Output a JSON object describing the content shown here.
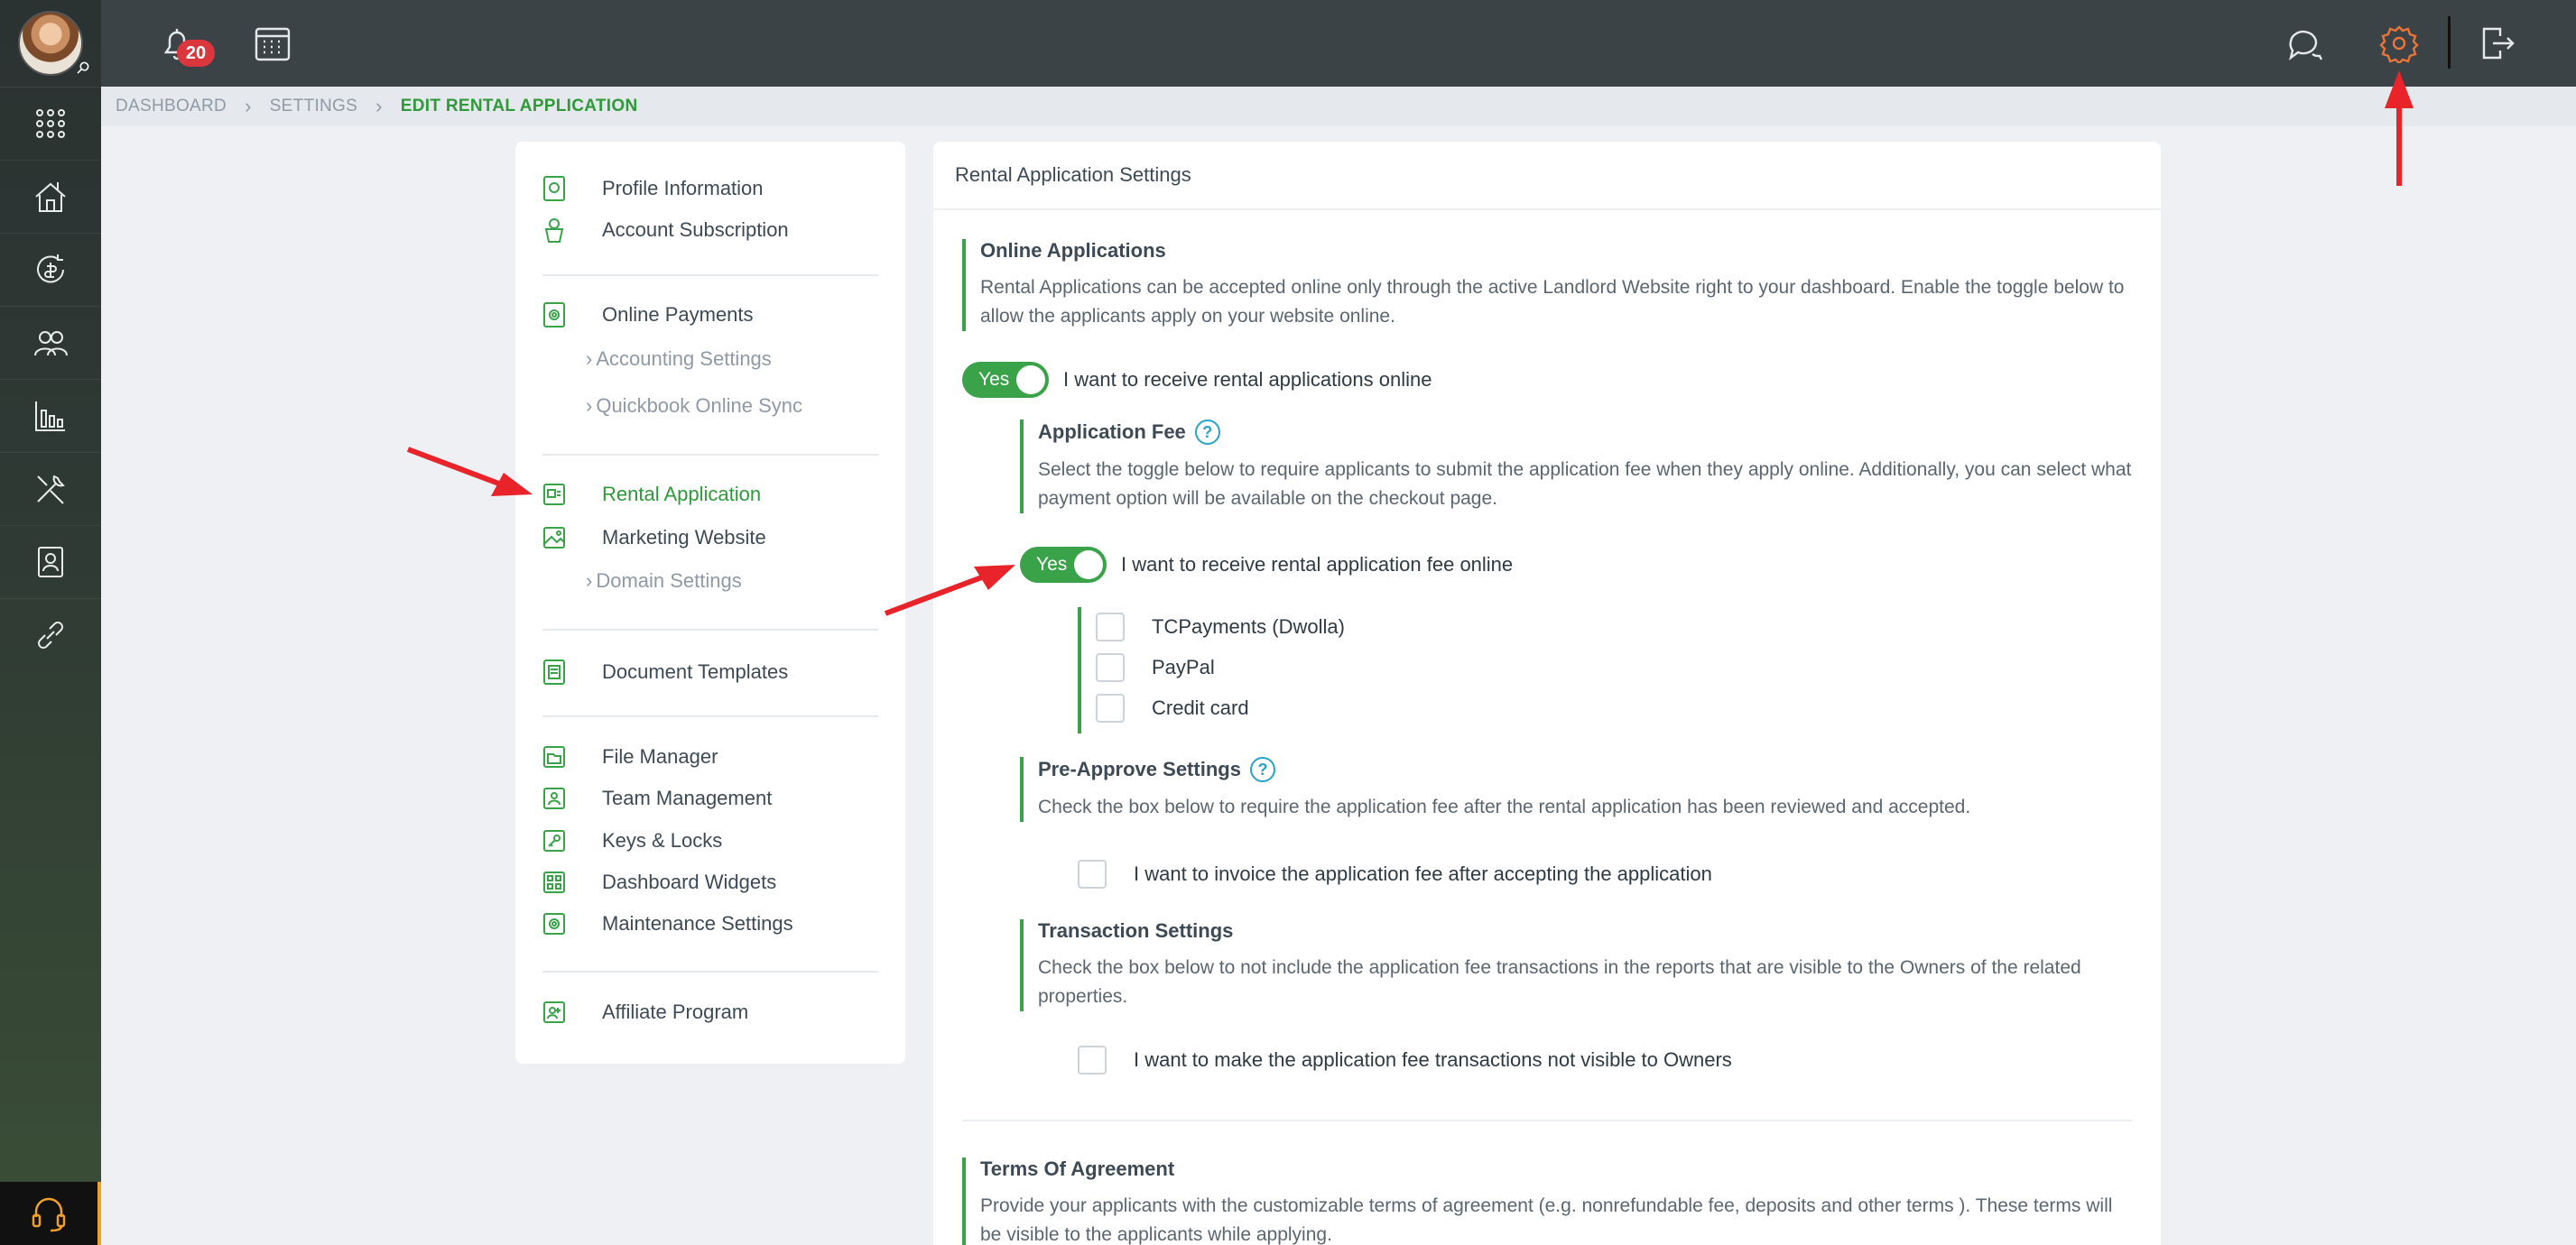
{
  "rail": {
    "items": [
      "apps-grid-icon",
      "properties-icon",
      "payments-icon",
      "people-icon",
      "reports-icon",
      "tools-icon",
      "contacts-icon",
      "link-icon"
    ],
    "support_icon": "headset-icon"
  },
  "topbar": {
    "notifications_count": "20",
    "icons": [
      "bell-icon",
      "calendar-icon",
      "chat-icon",
      "gear-icon",
      "logout-icon"
    ]
  },
  "breadcrumb": {
    "items": [
      "DASHBOARD",
      "SETTINGS"
    ],
    "current": "EDIT RENTAL APPLICATION"
  },
  "nav": {
    "profile_information": "Profile Information",
    "account_subscription": "Account Subscription",
    "online_payments": "Online Payments",
    "accounting_settings": "Accounting Settings",
    "quickbook_sync": "Quickbook Online Sync",
    "rental_application": "Rental Application",
    "marketing_website": "Marketing Website",
    "domain_settings": "Domain Settings",
    "document_templates": "Document Templates",
    "file_manager": "File Manager",
    "team_management": "Team Management",
    "keys_locks": "Keys & Locks",
    "dashboard_widgets": "Dashboard Widgets",
    "maintenance_settings": "Maintenance Settings",
    "affiliate_program": "Affiliate Program"
  },
  "main": {
    "header": "Rental Application Settings",
    "online_apps": {
      "title": "Online Applications",
      "text": "Rental Applications can be accepted online only through the active Landlord Website right to your dashboard. Enable the toggle below to allow the applicants apply on your website online.",
      "toggle_state": "Yes",
      "toggle_label": "I want to receive rental applications online"
    },
    "app_fee": {
      "title": "Application Fee",
      "text": "Select the toggle below to require applicants to submit the application fee when they apply online. Additionally, you can select what payment option will be available on the checkout page.",
      "toggle_state": "Yes",
      "toggle_label": "I want to receive rental application fee online",
      "options": [
        "TCPayments (Dwolla)",
        "PayPal",
        "Credit card"
      ]
    },
    "pre_approve": {
      "title": "Pre-Approve Settings",
      "text": "Check the box below to require the application fee after the rental application has been reviewed and accepted.",
      "checkbox_label": "I want to invoice the application fee after accepting the application"
    },
    "transaction": {
      "title": "Transaction Settings",
      "text": "Check the box below to not include the application fee transactions in the reports that are visible to the Owners of the related properties.",
      "checkbox_label": "I want to make the application fee transactions not visible to Owners"
    },
    "terms": {
      "title": "Terms Of Agreement",
      "text": "Provide your applicants with the customizable terms of agreement (e.g. nonrefundable fee, deposits and other terms ). These terms will be visible to the applicants while applying."
    },
    "help_symbol": "?"
  },
  "colors": {
    "accent_green": "#3aa34a",
    "annotation_red": "#e8232a",
    "badge_red": "#d9363e"
  }
}
